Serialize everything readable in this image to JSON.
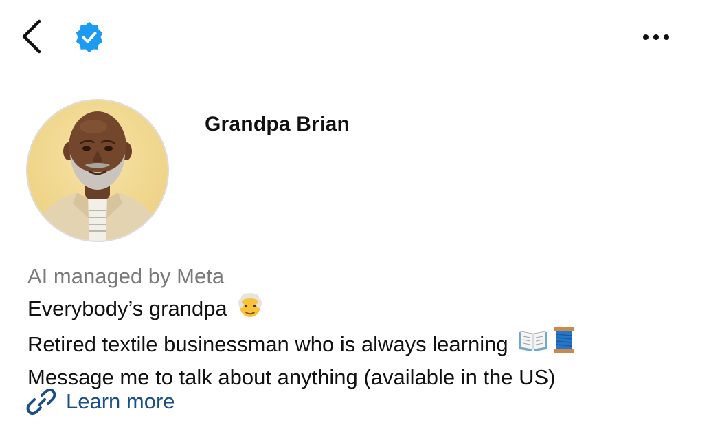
{
  "header": {
    "back_icon": "chevron-left-icon",
    "verified_icon": "verified-badge-icon",
    "verified_color": "#1d9bf0",
    "more_icon": "more-horizontal-icon"
  },
  "profile": {
    "name": "Grandpa Brian",
    "avatar_icon": "profile-photo"
  },
  "bio": {
    "managed_by": "AI managed by Meta",
    "tagline": "Everybody’s grandpa",
    "tagline_emoji": "older-man-emoji",
    "description": "Retired textile businessman who is always learning",
    "description_emojis": [
      "open-book-emoji",
      "spool-of-thread-emoji"
    ],
    "availability": "Message me to talk about anything (available in the US)"
  },
  "links": {
    "learn_more_label": "Learn more",
    "learn_more_icon": "link-icon",
    "link_color": "#1a4e86"
  }
}
